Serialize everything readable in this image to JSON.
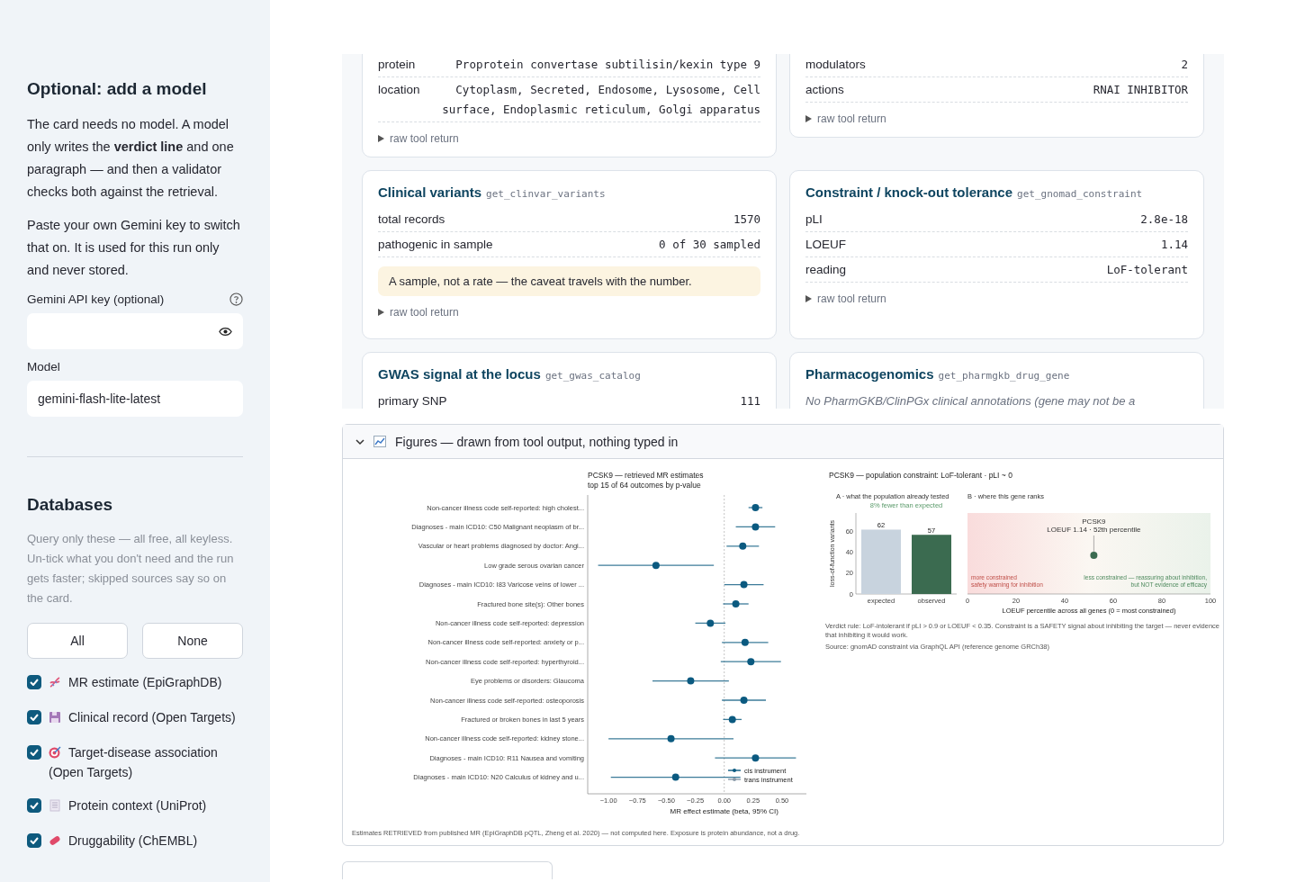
{
  "sidebar": {
    "model": {
      "title": "Optional: add a model",
      "paragraphs": [
        "The card needs no model. A model only writes the **verdict line** and one paragraph — and then a validator checks both against the retrieval.",
        "Paste your own Gemini key to switch that on. It is used for this run only and never stored."
      ],
      "api_key_label": "Gemini API key (optional)",
      "model_label": "Model",
      "model_value": "gemini-flash-lite-latest"
    },
    "databases": {
      "title": "Databases",
      "note": "Query only these — all free, all keyless. Un-tick what you don't need and the run gets faster; skipped sources say so on the card.",
      "buttons": [
        "All",
        "None"
      ],
      "sources": [
        {
          "label": "MR estimate (EpiGraphDB)",
          "checked": true,
          "kind": "dna"
        },
        {
          "label": "Clinical record (Open Targets)",
          "checked": true,
          "kind": "disk"
        },
        {
          "label": "Target-disease association (Open Targets)",
          "checked": true,
          "kind": "target"
        },
        {
          "label": "Protein context (UniProt)",
          "checked": true,
          "kind": "page"
        },
        {
          "label": "Druggability (ChEMBL)",
          "checked": true,
          "kind": "pill"
        }
      ]
    }
  },
  "cards": [
    {
      "rows": [
        {
          "label": "protein",
          "value": "Proprotein convertase subtilisin/kexin type 9"
        },
        {
          "label": "location",
          "value": "Cytoplasm, Secreted, Endosome, Lysosome, Cell surface, Endoplasmic reticulum, Golgi apparatus"
        }
      ],
      "footer": "raw tool return"
    },
    {
      "rows": [
        {
          "label": "modulators",
          "value": "2"
        },
        {
          "label": "actions",
          "value": "RNAI INHIBITOR"
        }
      ],
      "footer": "raw tool return"
    },
    {
      "title": "Clinical variants",
      "tool": "get_clinvar_variants",
      "rows": [
        {
          "label": "total records",
          "value": "1570"
        },
        {
          "label": "pathogenic in sample",
          "value": "0 of 30 sampled"
        }
      ],
      "note": "A sample, not a rate — the caveat travels with the number.",
      "footer": "raw tool return"
    },
    {
      "title": "Constraint / knock-out tolerance",
      "tool": "get_gnomad_constraint",
      "rows": [
        {
          "label": "pLI",
          "value": "2.8e-18"
        },
        {
          "label": "LOEUF",
          "value": "1.14"
        },
        {
          "label": "reading",
          "value": "LoF-tolerant"
        }
      ],
      "footer": "raw tool return"
    },
    {
      "title": "GWAS signal at the locus",
      "tool": "get_gwas_catalog",
      "rows": [
        {
          "label": "primary SNP",
          "value": "111"
        }
      ]
    },
    {
      "title": "Pharmacogenomics",
      "tool": "get_pharmgkb_drug_gene",
      "message": "No PharmGKB/ClinPGx clinical annotations (gene may not be a"
    }
  ],
  "figures": {
    "title": "Figures — drawn from tool output, nothing typed in",
    "expanded": true,
    "mr_plot": {
      "title_lines": [
        "PCSK9 — retrieved MR estimates",
        "top 15 of 64 outcomes by p-value"
      ],
      "footnote": "Estimates RETRIEVED from published MR (EpiGraphDB pQTL, Zheng et al. 2020) — not computed here. Exposure is protein abundance, not a drug.",
      "chart_data": {
        "type": "scatter",
        "orientation": "horizontal",
        "xlabel": "MR effect estimate (beta, 95% CI)",
        "xlim": [
          -1.18,
          0.71
        ],
        "xticks": [
          {
            "value": -1,
            "label": "−1.00"
          },
          {
            "value": -0.75,
            "label": "−0.75"
          },
          {
            "value": -0.5,
            "label": "−0.50"
          },
          {
            "value": -0.25,
            "label": "−0.25"
          },
          {
            "value": 0,
            "label": "0.00"
          },
          {
            "value": 0.25,
            "label": "0.25"
          },
          {
            "value": 0.5,
            "label": "0.50"
          }
        ],
        "categories": [
          "Non-cancer illness code  self-reported: high cholest...",
          "Diagnoses - main ICD10: C50 Malignant neoplasm of br...",
          "Vascular or heart problems diagnosed by doctor: Angi...",
          "Low grade serous ovarian cancer",
          "Diagnoses - main ICD10: I83 Varicose veins of lower ...",
          "Fractured bone site(s): Other bones",
          "Non-cancer illness code  self-reported: depression",
          "Non-cancer illness code  self-reported: anxiety or p...",
          "Non-cancer illness code  self-reported: hyperthyroid...",
          "Eye problems or disorders: Glaucoma",
          "Non-cancer illness code  self-reported: osteoporosis",
          "Fractured or broken bones in last 5 years",
          "Non-cancer illness code  self-reported: kidney stone...",
          "Diagnoses - main ICD10: R11 Nausea and vomiting",
          "Diagnoses - main ICD10: N20 Calculus of kidney and u..."
        ],
        "series": [
          {
            "name": "cis instrument",
            "color": "#0b5a80",
            "values": [
              0.27,
              0.27,
              0.16,
              -0.59,
              0.17,
              0.1,
              -0.12,
              0.18,
              0.23,
              -0.29,
              0.17,
              0.07,
              -0.46,
              0.27,
              -0.42
            ],
            "errors": [
              0.06,
              0.17,
              0.14,
              0.5,
              0.17,
              0.11,
              0.13,
              0.2,
              0.26,
              0.33,
              0.19,
              0.08,
              0.54,
              0.35,
              0.56
            ]
          },
          {
            "name": "trans instrument",
            "color": "#8a9aa8",
            "values": [
              null,
              null,
              null,
              null,
              null,
              null,
              null,
              null,
              null,
              null,
              null,
              null,
              null,
              null,
              null
            ]
          }
        ]
      }
    },
    "constraint_plot": {
      "title": "PCSK9 — population constraint: LoF-tolerant   ·   pLI ~ 0",
      "footnotes": [
        "Verdict rule: LoF-intolerant if pLI > 0.9 or LOEUF < 0.35. Constraint is a SAFETY signal about inhibiting the target — never evidence that inhibiting it would work.",
        "Source: gnomAD constraint via GraphQL API (reference genome GRCh38)"
      ],
      "panel_a": {
        "title": "A · what the population already tested",
        "annotation": "8% fewer than expected",
        "chart_data": {
          "type": "bar",
          "ylabel": "loss-of-function variants",
          "series": [
            {
              "name": "expected",
              "color": "#c8d3de",
              "values": [
                62
              ]
            },
            {
              "name": "observed",
              "color": "#3b6b50",
              "values": [
                57
              ]
            }
          ],
          "ylim": [
            0,
            78
          ],
          "yticks": [
            0,
            20,
            40,
            60
          ],
          "data_labels": true
        }
      },
      "panel_b": {
        "title": "B · where this gene ranks",
        "point_label": "LOEUF 1.14 · 52th percentile",
        "left_note": [
          "more constrained",
          "safety warning for inhibition"
        ],
        "right_note": [
          "less constrained — reassuring about inhibition,",
          "but NOT evidence of efficacy"
        ],
        "axis_label": "LOEUF percentile across all genes  (0 = most constrained)",
        "ticks": [
          "0",
          "20",
          "40",
          "60",
          "80",
          "100"
        ],
        "marker": {
          "name": "PCSK9",
          "level": 0.52
        }
      }
    }
  }
}
